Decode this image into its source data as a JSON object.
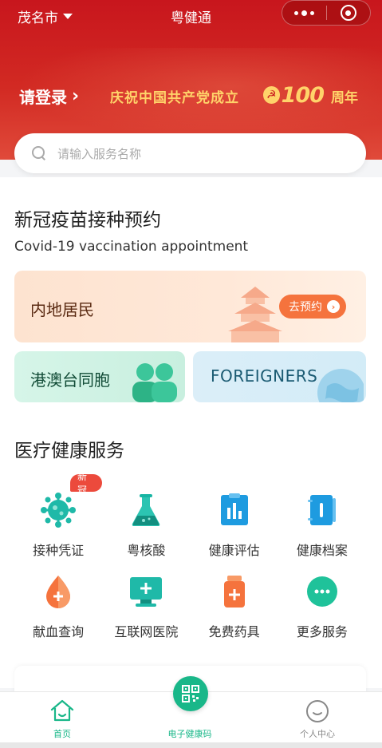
{
  "topbar": {
    "city": "茂名市",
    "title": "粤健通"
  },
  "banner": {
    "login": "请登录",
    "slogan": "庆祝中国共产党成立",
    "number": "100",
    "suffix": "周年"
  },
  "search": {
    "placeholder": "请输入服务名称"
  },
  "vaccine": {
    "title": "新冠疫苗接种预约",
    "subtitle": "Covid-19 vaccination appointment",
    "mainland_label": "内地居民",
    "book_label": "去预约",
    "hk_label": "港澳台同胞",
    "foreign_label": "FOREIGNERS"
  },
  "medical": {
    "title": "医疗健康服务",
    "items": [
      {
        "label": "接种凭证",
        "icon": "virus-icon",
        "badge": "新冠"
      },
      {
        "label": "粤核酸",
        "icon": "flask-icon"
      },
      {
        "label": "健康评估",
        "icon": "chart-clipboard-icon"
      },
      {
        "label": "健康档案",
        "icon": "record-book-icon"
      },
      {
        "label": "献血查询",
        "icon": "blood-drop-icon"
      },
      {
        "label": "互联网医院",
        "icon": "monitor-plus-icon"
      },
      {
        "label": "免费药具",
        "icon": "medicine-bottle-icon"
      },
      {
        "label": "更多服务",
        "icon": "more-dots-icon"
      }
    ]
  },
  "tabbar": {
    "home": "首页",
    "code": "电子健康码",
    "me": "个人中心"
  },
  "colors": {
    "header_red": "#c8161d",
    "accent_green": "#19b789",
    "accent_orange": "#f5733d",
    "gold": "#ffd36a"
  }
}
